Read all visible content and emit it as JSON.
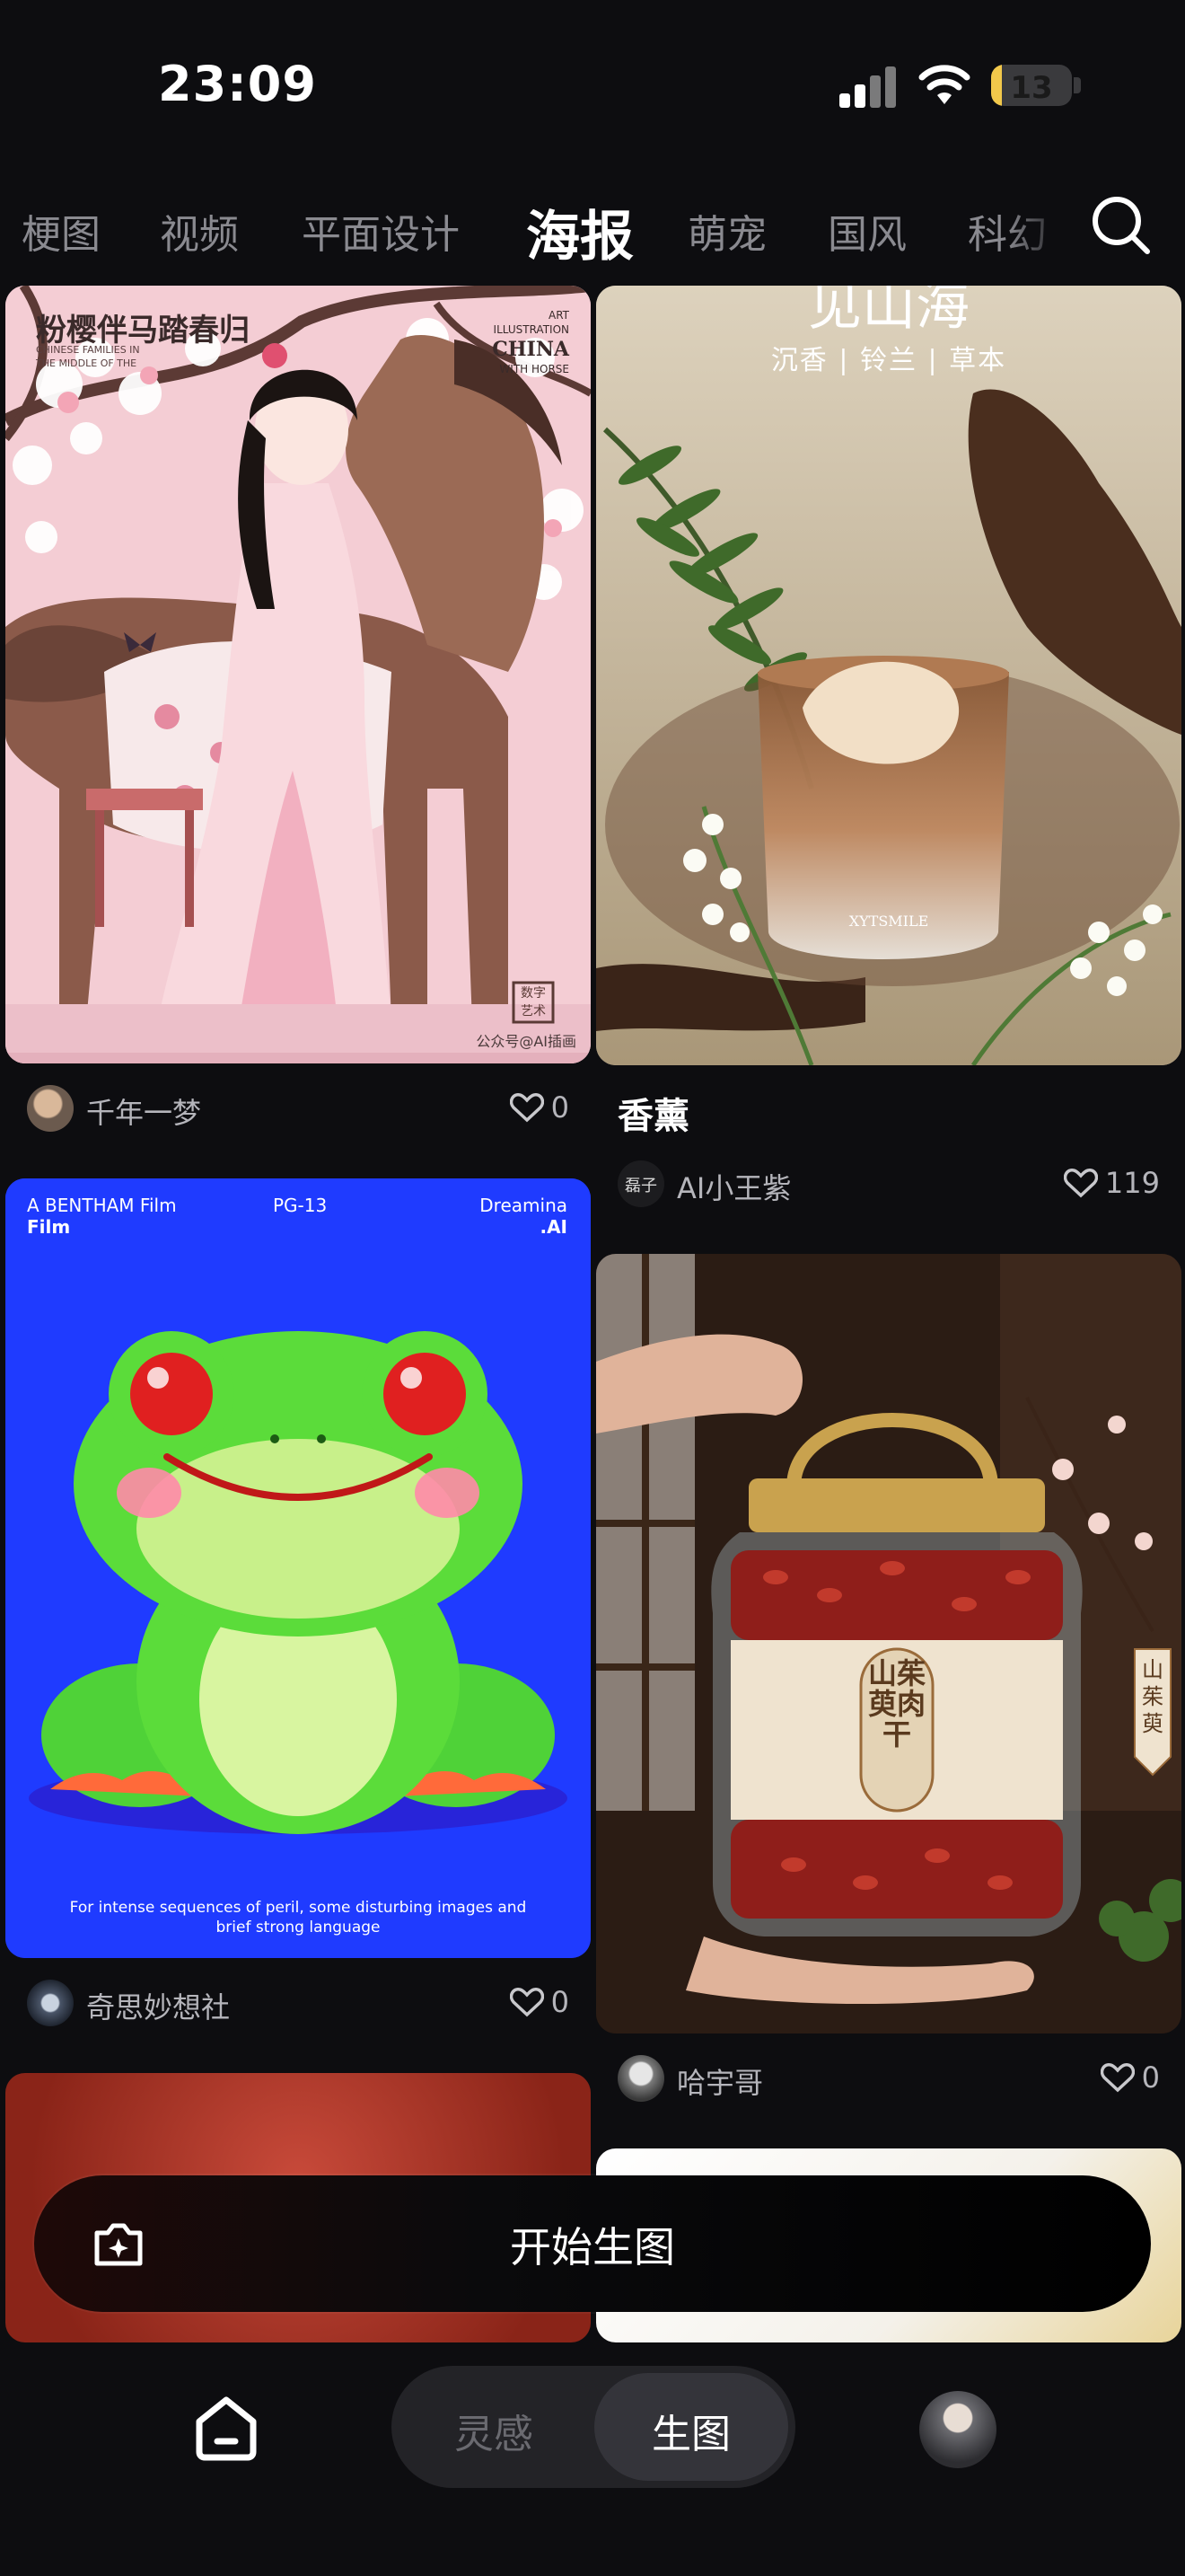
{
  "status_bar": {
    "time": "23:09",
    "battery": "13",
    "battery_level": 0.13
  },
  "tabs": {
    "items": [
      "梗图",
      "视频",
      "平面设计",
      "海报",
      "萌宠",
      "国风",
      "科幻"
    ],
    "active": "海报"
  },
  "feed": {
    "left": [
      {
        "image_texts": {
          "title": "粉樱伴马踏春归",
          "top_right_1": "ART",
          "top_right_2": "ILLUSTRATION",
          "top_right_3": "CHINA",
          "top_right_4": "WITH HORSE",
          "side": "CHINESE FAMILIES IN THE MIDDLE OF THE",
          "seal": "数字艺术",
          "bottom": "公众号@AI插画"
        },
        "author": "千年一梦",
        "likes": "0"
      },
      {
        "image_texts": {
          "studio": "A BENTHAM Film",
          "film": "Film",
          "rating": "PG-13",
          "brand": "Dreamina",
          "brand_sub": ".AI",
          "disclaimer_1": "For intense sequences of peril, some disturbing images and",
          "disclaimer_2": "brief strong language"
        },
        "author": "奇思妙想社",
        "likes": "0"
      }
    ],
    "right": [
      {
        "image_texts": {
          "headline": "见山海",
          "subline": "沉香 | 铃兰 | 草本",
          "glass_label": "XYTSMILE"
        },
        "title": "香薰",
        "author": "AI小王紫",
        "author_avatar_text": "磊子",
        "likes": "119"
      },
      {
        "image_texts": {
          "jar_label": "山茱萸肉干",
          "tag": "山茱萸"
        },
        "author": "哈宇哥",
        "likes": "0"
      }
    ]
  },
  "cta": {
    "label": "开始生图",
    "icon": "camera-sparkle-icon"
  },
  "bottom_nav": {
    "segment_left": "灵感",
    "segment_right": "生图",
    "home_icon": "home-icon",
    "profile_icon": "avatar"
  },
  "colors": {
    "background": "#0d0d10",
    "battery": "#f2c84b",
    "frog_bg": "#1f3bff",
    "poster_pink": "#f3c2cc"
  }
}
